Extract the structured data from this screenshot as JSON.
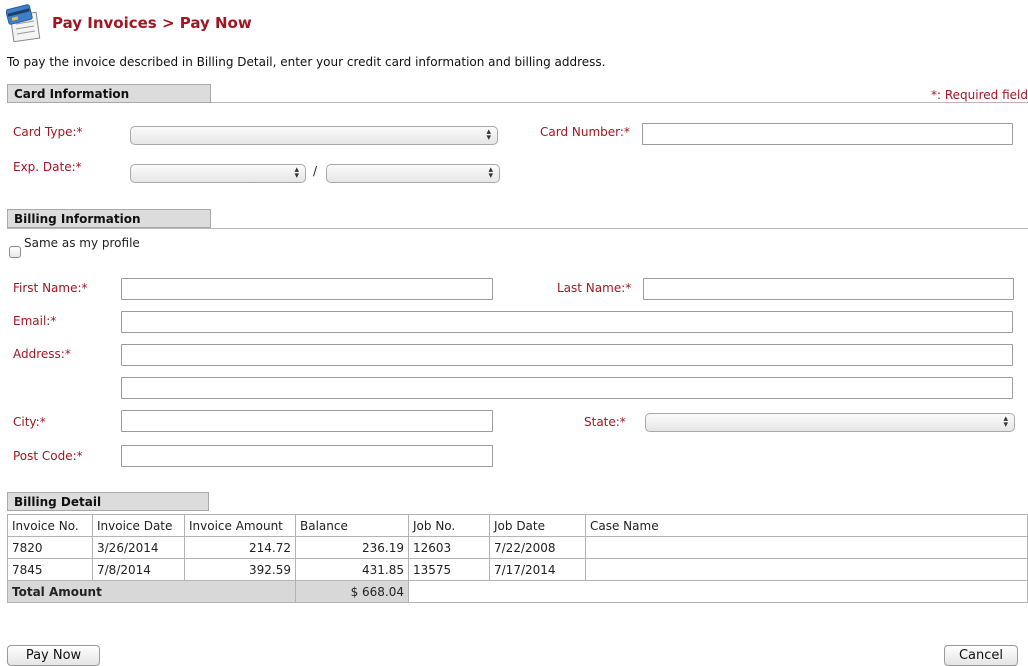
{
  "header": {
    "title": "Pay Invoices > Pay Now",
    "intro": "To pay the invoice described in Billing Detail, enter your credit card information and billing address."
  },
  "card_section": {
    "title": "Card Information",
    "required_note": "*: Required field",
    "card_type_label": "Card Type:*",
    "card_number_label": "Card Number:*",
    "exp_date_label": "Exp. Date:*",
    "exp_separator": "/",
    "card_type_value": "",
    "card_number_value": "",
    "exp_month_value": "",
    "exp_year_value": ""
  },
  "billing_section": {
    "title": "Billing Information",
    "same_as_profile_label": "Same as my profile",
    "same_as_profile_checked": false,
    "first_name_label": "First Name:*",
    "last_name_label": "Last Name:*",
    "email_label": "Email:*",
    "address_label": "Address:*",
    "city_label": "City:*",
    "state_label": "State:*",
    "post_code_label": "Post Code:*"
  },
  "billing_detail": {
    "title": "Billing Detail",
    "columns": [
      "Invoice No.",
      "Invoice Date",
      "Invoice Amount",
      "Balance",
      "Job No.",
      "Job Date",
      "Case Name"
    ],
    "rows": [
      [
        "7820",
        "3/26/2014",
        "214.72",
        "236.19",
        "12603",
        "7/22/2008",
        ""
      ],
      [
        "7845",
        "7/8/2014",
        "392.59",
        "431.85",
        "13575",
        "7/17/2014",
        ""
      ]
    ],
    "total_label": "Total Amount",
    "total_value": "$ 668.04"
  },
  "actions": {
    "pay_now_label": "Pay Now",
    "cancel_label": "Cancel"
  },
  "colors": {
    "accent_red": "#a01622",
    "section_tab_bg": "#dcdcdc"
  },
  "icons": {
    "header_icon": "credit-card-invoice-icon",
    "select_arrow": "select-updown-arrow-icon"
  }
}
